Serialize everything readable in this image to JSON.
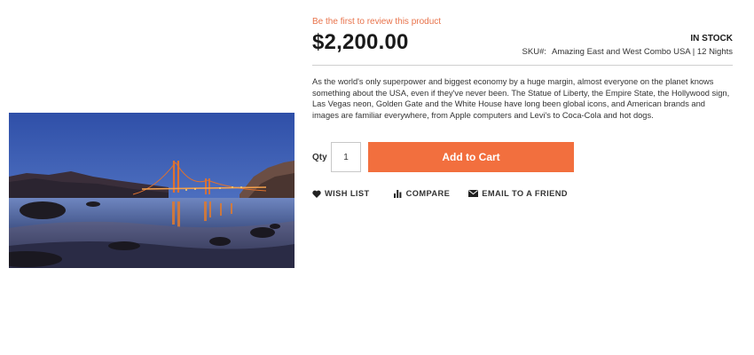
{
  "product": {
    "image_alt": "Golden Gate Bridge at dusk viewed from the beach",
    "review_link": "Be the first to review this product",
    "price": "$2,200.00",
    "stock_status": "IN STOCK",
    "sku_label": "SKU#:",
    "sku_value": "Amazing East and West Combo USA | 12 Nights",
    "description": "As the world's only superpower and biggest economy by a huge margin, almost everyone on the planet knows something about the USA, even if they've never been. The Statue of Liberty, the Empire State, the Hollywood sign, Las Vegas neon, Golden Gate and the White House have long been global icons, and American brands and images are familiar everywhere, from Apple computers and Levi's to Coca-Cola and hot dogs."
  },
  "cart": {
    "qty_label": "Qty",
    "qty_value": "1",
    "add_to_cart_label": "Add to Cart"
  },
  "actions": {
    "wishlist_label": "WISH LIST",
    "compare_label": "COMPARE",
    "email_label": "EMAIL TO A FRIEND"
  },
  "icons": {
    "wishlist": "heart-icon",
    "compare": "bar-chart-icon",
    "email": "envelope-icon"
  },
  "colors": {
    "accent": "#f26f3e",
    "review_link": "#e8734b",
    "text": "#333333",
    "price": "#1a1a1a",
    "divider": "#cfcfcf"
  }
}
